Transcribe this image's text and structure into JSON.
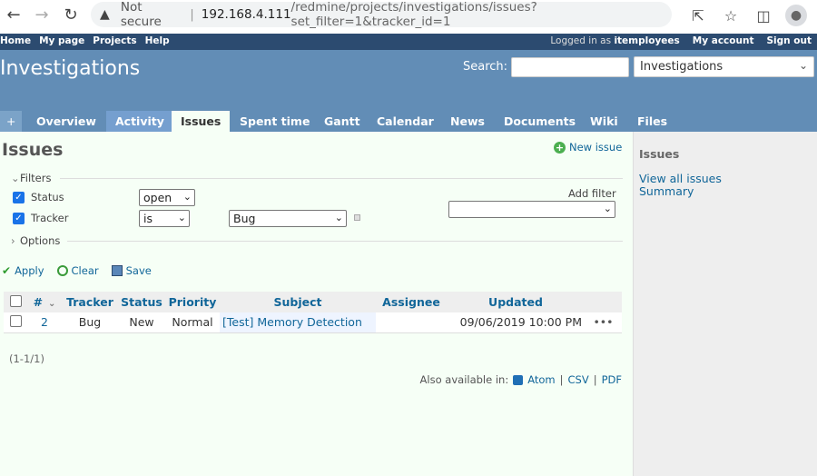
{
  "browser": {
    "not_secure": "Not secure",
    "host": "192.168.4.111",
    "path": "/redmine/projects/investigations/issues?set_filter=1&tracker_id=1"
  },
  "top_menu": {
    "left": [
      "Home",
      "My page",
      "Projects",
      "Help"
    ],
    "logged_in_as": "Logged in as",
    "user": "itemployees",
    "right": [
      "My account",
      "Sign out"
    ]
  },
  "header": {
    "project_title": "Investigations",
    "search_label": "Search:",
    "search_value": "",
    "jump_select": "Investigations"
  },
  "main_menu": {
    "plus": "+",
    "tabs": [
      "Overview",
      "Activity",
      "Issues",
      "Spent time",
      "Gantt",
      "Calendar",
      "News",
      "Documents",
      "Wiki",
      "Files"
    ],
    "selected": "Issues",
    "hover": "Activity"
  },
  "content": {
    "title": "Issues",
    "new_issue": "New issue",
    "filters_legend": "Filters",
    "options_legend": "Options",
    "filters": [
      {
        "label": "Status",
        "operator": "open",
        "checked": true
      },
      {
        "label": "Tracker",
        "operator": "is",
        "value": "Bug",
        "checked": true
      }
    ],
    "add_filter_label": "Add filter",
    "add_filter_value": "",
    "buttons": {
      "apply": "Apply",
      "clear": "Clear",
      "save": "Save"
    },
    "table": {
      "headers": [
        "#",
        "Tracker",
        "Status",
        "Priority",
        "Subject",
        "Assignee",
        "Updated"
      ],
      "rows": [
        {
          "id": "2",
          "tracker": "Bug",
          "status": "New",
          "priority": "Normal",
          "subject": "[Test] Memory Detection",
          "assignee": "",
          "updated": "09/06/2019 10:00 PM",
          "actions": "•••"
        }
      ]
    },
    "pagination": "(1-1/1)",
    "also_available": "Also available in:",
    "formats": [
      "Atom",
      "CSV",
      "PDF"
    ],
    "format_sep": "|"
  },
  "sidebar": {
    "title": "Issues",
    "links": [
      "View all issues",
      "Summary"
    ]
  },
  "colors": {
    "top_menu_bg": "#2c4b70",
    "header_bg": "#628db6",
    "content_bg": "#f6fff6",
    "link": "#169"
  }
}
